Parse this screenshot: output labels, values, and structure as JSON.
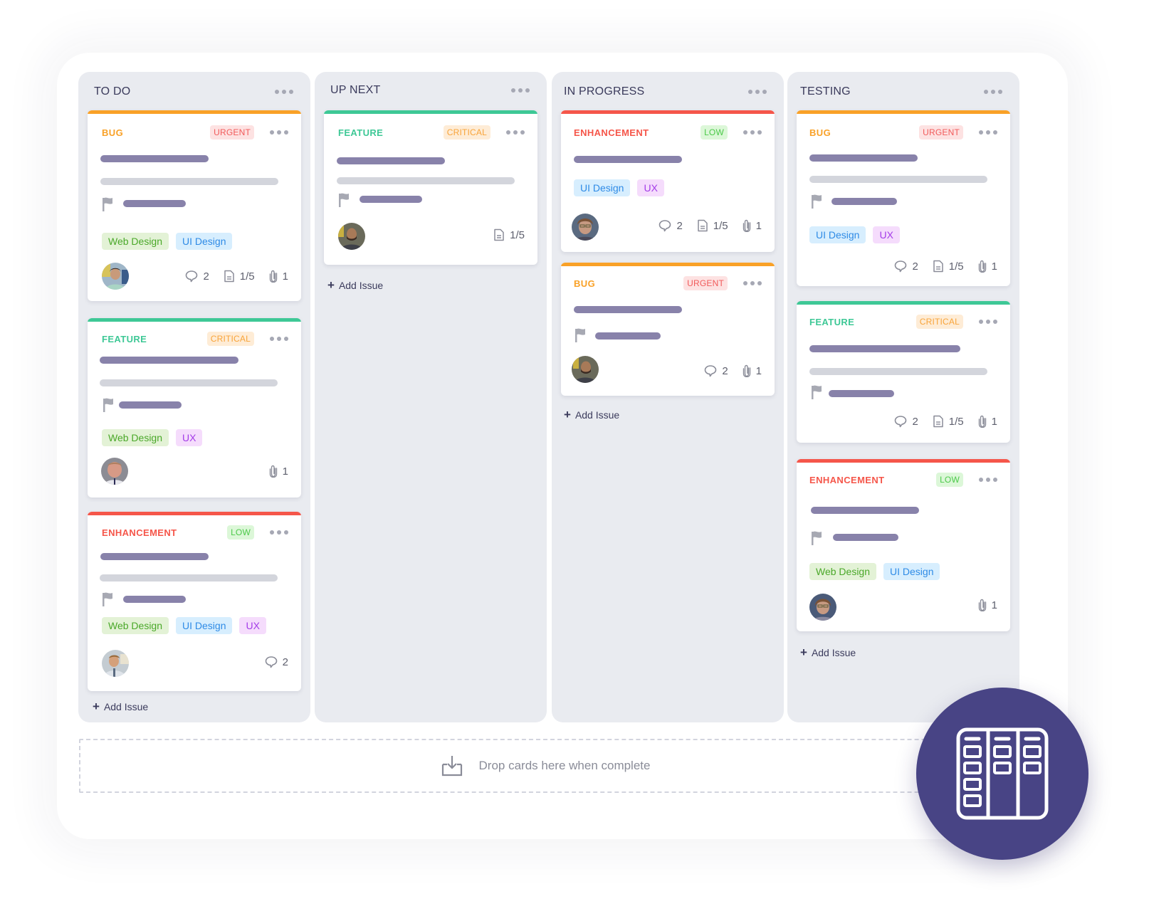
{
  "colors": {
    "bug": "#f9a127",
    "feature": "#3ec896",
    "enhancement": "#f5564a",
    "urgent_bg": "#fde2e2",
    "urgent_fg": "#f15a5a",
    "critical_bg": "#feecd6",
    "critical_fg": "#f8a43a",
    "low_bg": "#dcf7d8",
    "low_fg": "#4cc94a",
    "fab": "#484485"
  },
  "columns": [
    {
      "title": "TO DO",
      "add_label": "Add Issue",
      "cards": [
        {
          "type": "BUG",
          "priority": "URGENT",
          "tags": [
            "Web Design",
            "UI Design"
          ],
          "comments": "2",
          "subtasks": "1/5",
          "attachments": "1"
        },
        {
          "type": "FEATURE",
          "priority": "CRITICAL",
          "tags": [
            "Web Design",
            "UX"
          ],
          "attachments": "1"
        },
        {
          "type": "ENHANCEMENT",
          "priority": "LOW",
          "tags": [
            "Web Design",
            "UI Design",
            "UX"
          ],
          "comments": "2"
        }
      ]
    },
    {
      "title": "UP NEXT",
      "add_label": "Add Issue",
      "cards": [
        {
          "type": "FEATURE",
          "priority": "CRITICAL",
          "tags": [],
          "subtasks": "1/5"
        }
      ]
    },
    {
      "title": "IN PROGRESS",
      "add_label": "Add Issue",
      "cards": [
        {
          "type": "ENHANCEMENT",
          "priority": "LOW",
          "tags": [
            "UI Design",
            "UX"
          ],
          "comments": "2",
          "subtasks": "1/5",
          "attachments": "1"
        },
        {
          "type": "BUG",
          "priority": "URGENT",
          "tags": [],
          "comments": "2",
          "attachments": "1"
        }
      ]
    },
    {
      "title": "TESTING",
      "add_label": "Add Issue",
      "cards": [
        {
          "type": "BUG",
          "priority": "URGENT",
          "tags": [
            "UI Design",
            "UX"
          ],
          "comments": "2",
          "subtasks": "1/5",
          "attachments": "1"
        },
        {
          "type": "FEATURE",
          "priority": "CRITICAL",
          "tags": [],
          "comments": "2",
          "subtasks": "1/5",
          "attachments": "1"
        },
        {
          "type": "ENHANCEMENT",
          "priority": "LOW",
          "tags": [
            "Web Design",
            "UI Design"
          ],
          "attachments": "1"
        }
      ]
    }
  ],
  "dropzone": {
    "label": "Drop cards here when complete",
    "icon": "download-tray-icon"
  },
  "fab": {
    "icon": "kanban-board-icon"
  }
}
